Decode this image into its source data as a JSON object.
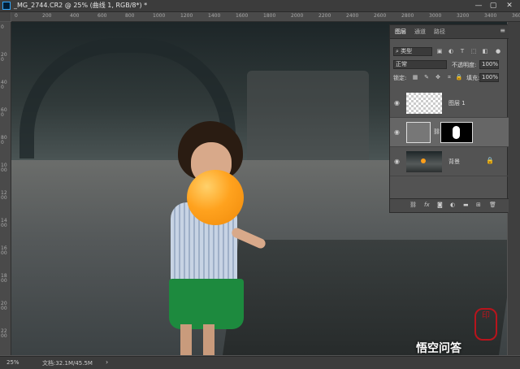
{
  "window": {
    "title": "_MG_2744.CR2 @ 25% (曲线 1, RGB/8*) *",
    "minimize": "—",
    "maximize": "▢",
    "close": "✕"
  },
  "rulers": {
    "top": [
      "0",
      "200",
      "400",
      "600",
      "800",
      "1000",
      "1200",
      "1400",
      "1600",
      "1800",
      "2000",
      "2200",
      "2400",
      "2600",
      "2800",
      "3000",
      "3200",
      "3400",
      "3600"
    ],
    "left": [
      "0",
      "200",
      "400",
      "600",
      "800",
      "1000",
      "1200",
      "1400",
      "1600",
      "1800",
      "2000",
      "2200"
    ]
  },
  "layers_panel": {
    "tabs": [
      "图层",
      "通道",
      "路径"
    ],
    "menu": "≡",
    "filter_label": "类型",
    "blend_mode": "正常",
    "opacity_label": "不透明度:",
    "opacity_value": "100%",
    "lock_label": "锁定:",
    "fill_label": "填充:",
    "fill_value": "100%",
    "layers": [
      {
        "name": "图层 1",
        "visible": true
      },
      {
        "name": "",
        "visible": true,
        "selected": true
      },
      {
        "name": "背景",
        "visible": true,
        "locked": true
      }
    ],
    "footer_icons": [
      "link-icon",
      "fx-icon",
      "mask-icon",
      "adjustment-icon",
      "folder-icon",
      "new-layer-icon",
      "trash-icon"
    ]
  },
  "status": {
    "zoom": "25%",
    "doc": "文档:32.1M/45.5M",
    "arrow": "›"
  },
  "watermark": "悟空问答",
  "seal_text": "印"
}
